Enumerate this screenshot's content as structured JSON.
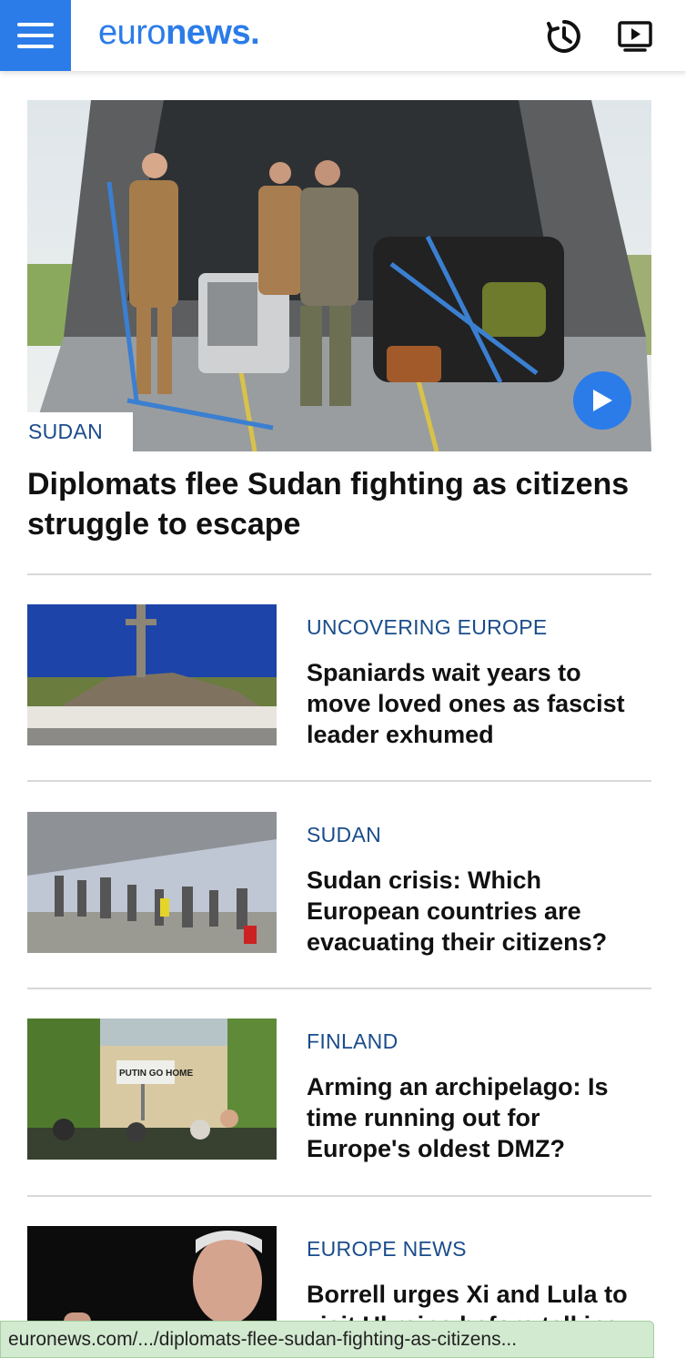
{
  "header": {
    "logo_light": "euro",
    "logo_bold": "news.",
    "accent_color": "#2b7ce9",
    "icons": [
      "menu-icon",
      "clock-icon",
      "video-icon"
    ]
  },
  "hero": {
    "tag": "SUDAN",
    "title": "Diplomats flee Sudan fighting as citizens struggle to escape"
  },
  "articles": [
    {
      "tag": "UNCOVERING EUROPE",
      "title": "Spaniards wait years to move loved ones as fascist leader exhumed"
    },
    {
      "tag": "SUDAN",
      "title": "Sudan crisis: Which European countries are evacuating their citizens?"
    },
    {
      "tag": "FINLAND",
      "title": "Arming an archipelago: Is time running out for Europe's oldest DMZ?",
      "image_sign": "PUTIN GO HOME"
    },
    {
      "tag": "EUROPE NEWS",
      "title": "Borrell urges Xi and Lula to visit Ukraine before talking"
    }
  ],
  "status_bar": {
    "url": "euronews.com/.../diplomats-flee-sudan-fighting-as-citizens..."
  }
}
